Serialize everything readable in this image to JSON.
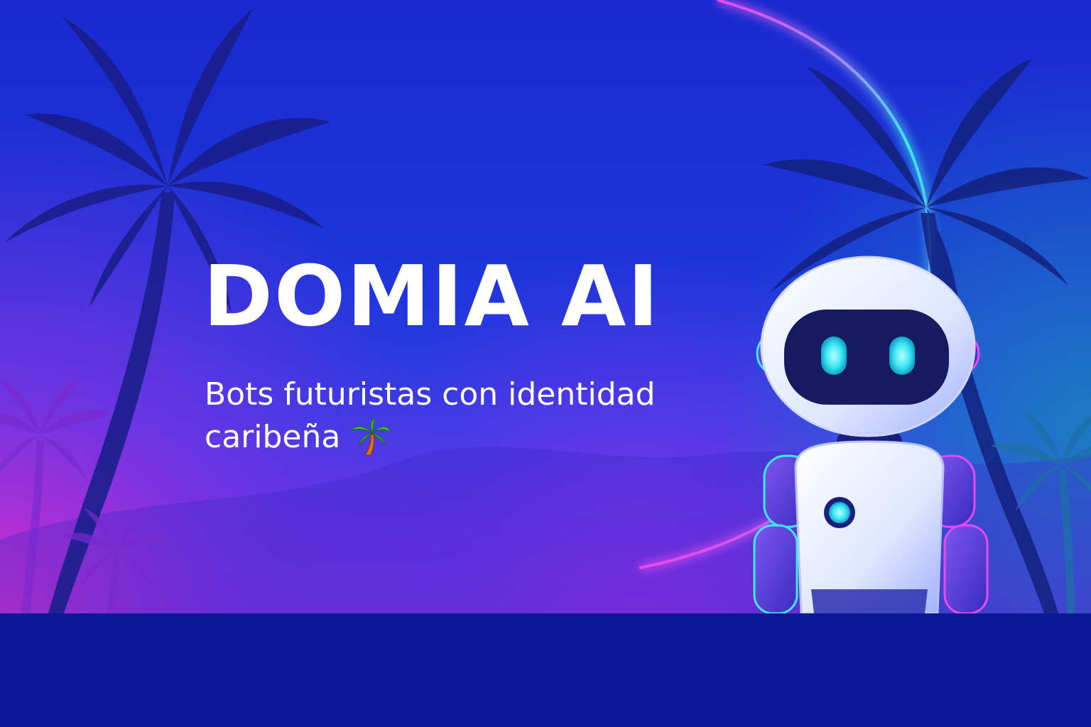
{
  "brand": {
    "title": "DOMIA AI",
    "tagline_line1": "Bots futuristas con identidad",
    "tagline_line2": "caribeña",
    "tagline_icon": "palm-tree-emoji"
  },
  "theme": {
    "background_primary": "#1b34d8",
    "background_accent": "#c026d3",
    "footer": "#0c1896",
    "text": "#ffffff",
    "glow": "#3ee8f5"
  },
  "illustration": {
    "subject": "robot",
    "scenery": "palm-trees"
  }
}
